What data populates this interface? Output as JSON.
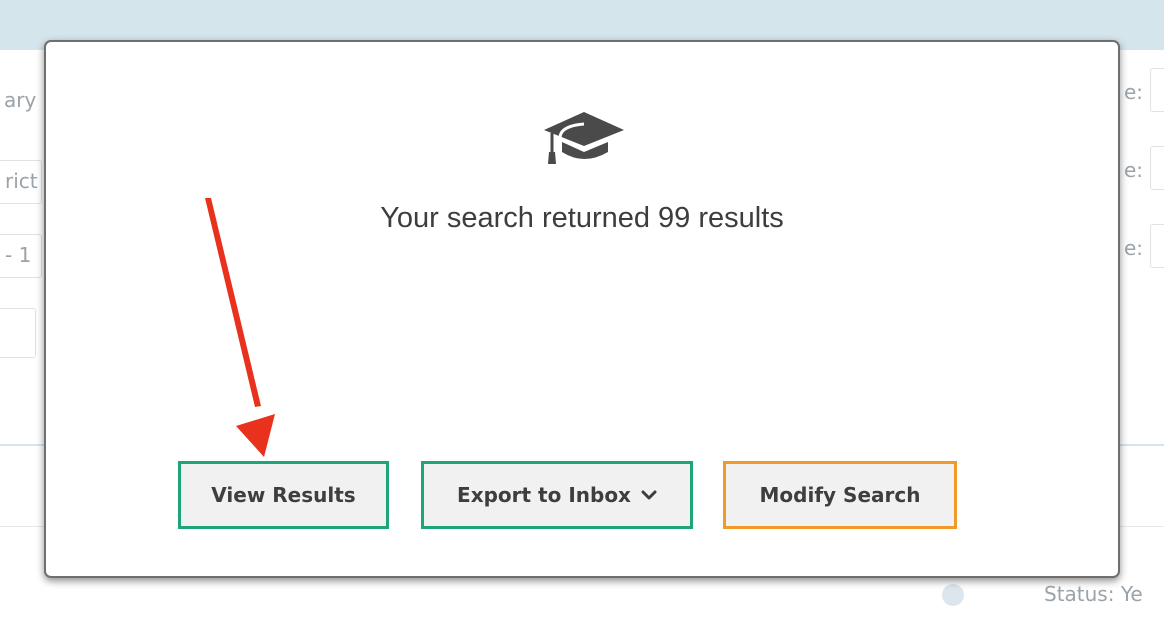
{
  "background": {
    "left_fragments": [
      "ary",
      "rict",
      "- 1"
    ],
    "right_fragments": [
      "e:",
      "e:",
      "e:"
    ],
    "footer_fragment": "Status: Ye"
  },
  "modal": {
    "icon": "graduation-cap-icon",
    "message": "Your search returned 99 results",
    "buttons": {
      "view_results": "View Results",
      "export_to_inbox": "Export to Inbox",
      "modify_search": "Modify Search"
    }
  },
  "annotation": {
    "arrow_color": "#e8321e",
    "arrow_target": "view-results-button"
  },
  "colors": {
    "accent_green": "#1fa57c",
    "accent_orange": "#ef9a2a",
    "header_bg": "#d5e5ec"
  }
}
